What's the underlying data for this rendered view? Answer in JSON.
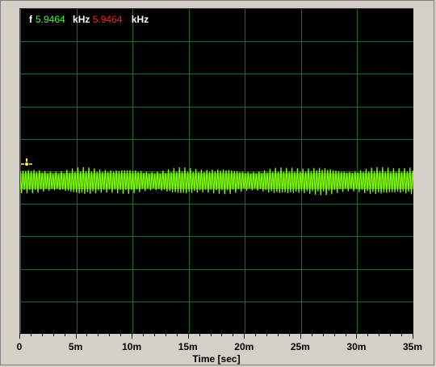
{
  "readout": {
    "prefix": "f",
    "value_a": "5.9464",
    "unit_a": "kHz",
    "value_b": "5.9464",
    "unit_b": "kHz"
  },
  "chart_data": {
    "type": "line",
    "xlabel": "Time [sec]",
    "xlim": [
      0,
      0.035
    ],
    "tick_labels": [
      "0",
      "5m",
      "10m",
      "15m",
      "20m",
      "25m",
      "30m",
      "35m"
    ],
    "tick_values": [
      0,
      0.005,
      0.01,
      0.015,
      0.02,
      0.025,
      0.03,
      0.035
    ],
    "grid": true,
    "grid_rows": 10,
    "series": [
      {
        "color": "#7cfc00",
        "band_center_fraction": 0.53,
        "band_halfwidth_fraction": 0.045
      }
    ],
    "cursor_color": "#ffff33",
    "background": "#000000",
    "grid_color": "#1f6b1f"
  }
}
